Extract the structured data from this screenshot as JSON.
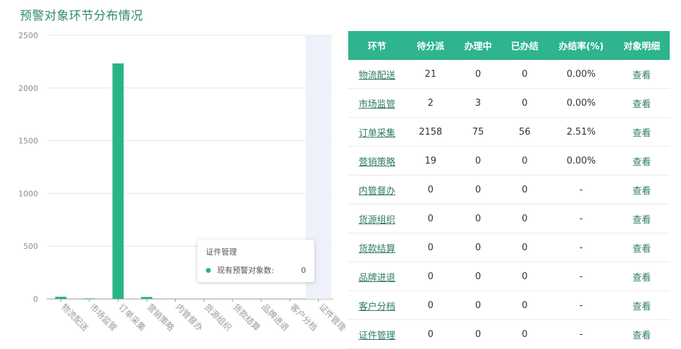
{
  "page_title": "预警对象环节分布情况",
  "tooltip": {
    "title": "证件管理",
    "series_label": "现有预警对象数:",
    "value": "0"
  },
  "table": {
    "headers": [
      "环节",
      "待分派",
      "办理中",
      "已办结",
      "办结率(%)",
      "对象明细"
    ],
    "rows": [
      {
        "name": "物流配送",
        "pending": "21",
        "processing": "0",
        "done": "0",
        "rate": "0.00%",
        "action": "查看"
      },
      {
        "name": "市场监管",
        "pending": "2",
        "processing": "3",
        "done": "0",
        "rate": "0.00%",
        "action": "查看"
      },
      {
        "name": "订单采集",
        "pending": "2158",
        "processing": "75",
        "done": "56",
        "rate": "2.51%",
        "action": "查看"
      },
      {
        "name": "营销策略",
        "pending": "19",
        "processing": "0",
        "done": "0",
        "rate": "0.00%",
        "action": "查看"
      },
      {
        "name": "内管督办",
        "pending": "0",
        "processing": "0",
        "done": "0",
        "rate": "-",
        "action": "查看"
      },
      {
        "name": "货源组织",
        "pending": "0",
        "processing": "0",
        "done": "0",
        "rate": "-",
        "action": "查看"
      },
      {
        "name": "货款结算",
        "pending": "0",
        "processing": "0",
        "done": "0",
        "rate": "-",
        "action": "查看"
      },
      {
        "name": "品牌进退",
        "pending": "0",
        "processing": "0",
        "done": "0",
        "rate": "-",
        "action": "查看"
      },
      {
        "name": "客户分档",
        "pending": "0",
        "processing": "0",
        "done": "0",
        "rate": "-",
        "action": "查看"
      },
      {
        "name": "证件管理",
        "pending": "0",
        "processing": "0",
        "done": "0",
        "rate": "-",
        "action": "查看"
      }
    ]
  },
  "chart_data": {
    "type": "bar",
    "categories": [
      "物流配送",
      "市场监管",
      "订单采集",
      "营销策略",
      "内管督办",
      "货源组织",
      "货款结算",
      "品牌进退",
      "客户分档",
      "证件管理"
    ],
    "series": [
      {
        "name": "现有预警对象数",
        "values": [
          21,
          5,
          2233,
          19,
          0,
          0,
          0,
          0,
          0,
          0
        ]
      }
    ],
    "ylim": [
      0,
      2500
    ],
    "yticks": [
      0,
      500,
      1000,
      1500,
      2000,
      2500
    ],
    "highlighted_category": "证件管理",
    "grid": true,
    "colors": {
      "bar": "#29b487",
      "highlight_band": "#eef1f9",
      "grid": "#e6e6e6"
    }
  }
}
